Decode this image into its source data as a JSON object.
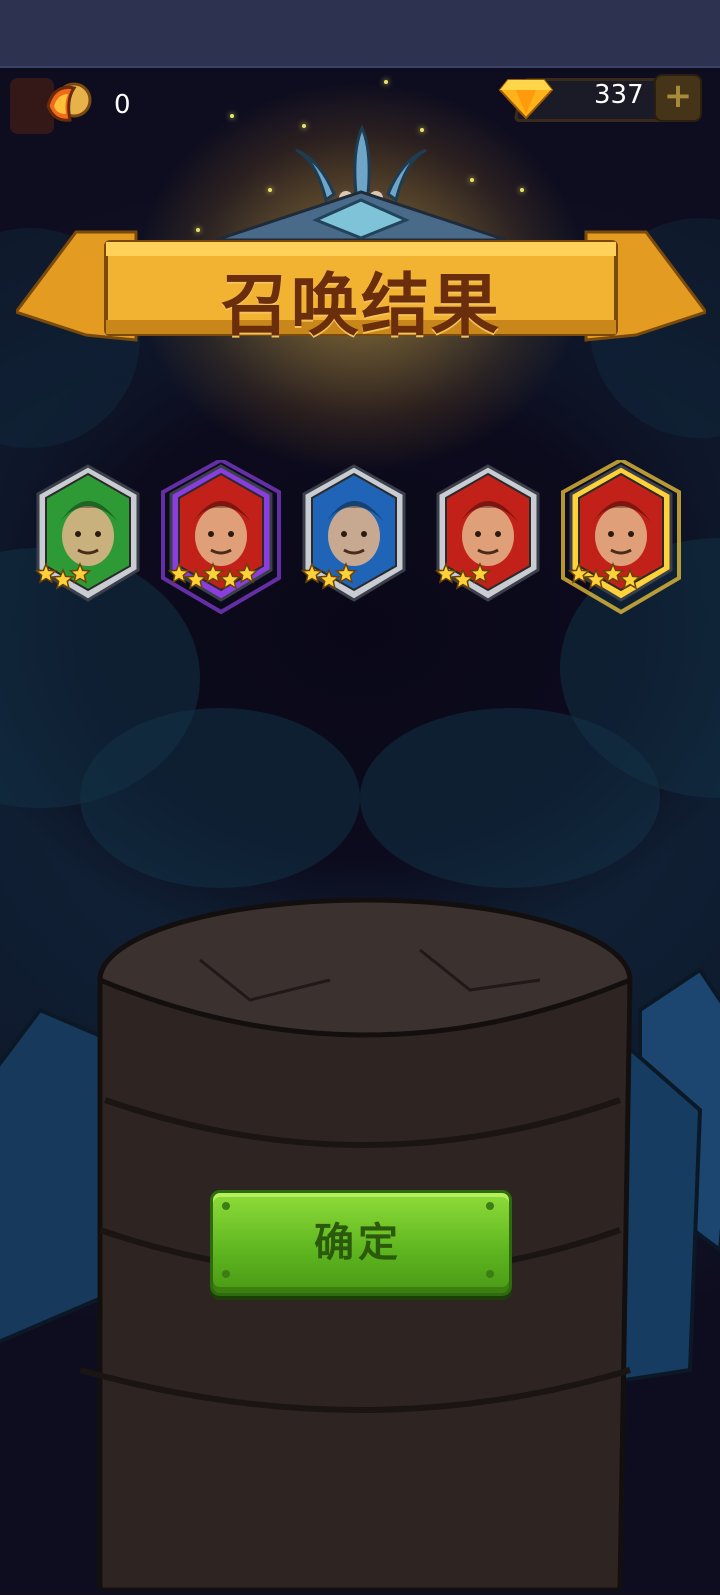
{
  "top_bar": {
    "token_icon": "summon-token-icon",
    "token_count": "0",
    "gem_icon": "gem-icon",
    "gem_count": "337",
    "add_icon": "plus-icon"
  },
  "banner": {
    "title": "召唤结果"
  },
  "heroes": [
    {
      "name_icon": "green-brute-hero-portrait",
      "stars": 3,
      "frame": "silver",
      "bg": "#2e9a35"
    },
    {
      "name_icon": "red-flame-woman-hero-portrait",
      "stars": 5,
      "frame": "purple",
      "bg": "#c2211a"
    },
    {
      "name_icon": "blue-hair-woman-hero-portrait",
      "stars": 3,
      "frame": "silver",
      "bg": "#1f64b6"
    },
    {
      "name_icon": "red-mane-warrior-hero-portrait",
      "stars": 3,
      "frame": "silver",
      "bg": "#c2211a"
    },
    {
      "name_icon": "red-turtle-beast-hero-portrait",
      "stars": 4,
      "frame": "gold",
      "bg": "#c2211a"
    }
  ],
  "confirm_button": {
    "label": "确定"
  },
  "colors": {
    "banner_gold": "#f2b232",
    "button_green": "#6cc624",
    "star_gold": "#ffd23a"
  }
}
